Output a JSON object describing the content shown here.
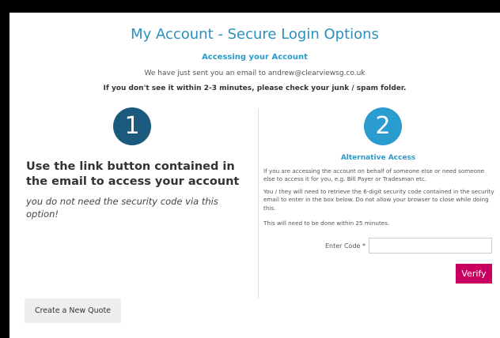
{
  "page": {
    "title": "My Account - Secure Login Options",
    "subtitle": "Accessing your Account",
    "sent_message": "We have just sent you an email to andrew@clearviewsg.co.uk",
    "junk_message": "If you don't see it within 2-3 minutes, please check your junk / spam folder."
  },
  "option_one": {
    "number": "1",
    "heading": "Use the link button contained in the email to access your account",
    "note": "you do not need the security code via this option!"
  },
  "option_two": {
    "number": "2",
    "heading": "Alternative Access",
    "paragraph_1": "If you are accessing the account on behalf of someone else or need someone else to access it for you, e.g. Bill Payer or Tradesman etc.",
    "paragraph_2": "You / they will need to retrieve the 6-digit security code contained in the security email to enter in the box below. Do not allow your browser to close while doing this.",
    "paragraph_3": "This will need to be done within 25 minutes.",
    "code_label": "Enter Code *",
    "code_value": "",
    "verify_label": "Verify"
  },
  "footer": {
    "new_quote_label": "Create a New Quote"
  },
  "colors": {
    "title": "#2b8fbf",
    "circle_one": "#1c5a7d",
    "circle_two": "#2a9cd0",
    "verify_button": "#c8005f",
    "background_frame": "#000000"
  }
}
